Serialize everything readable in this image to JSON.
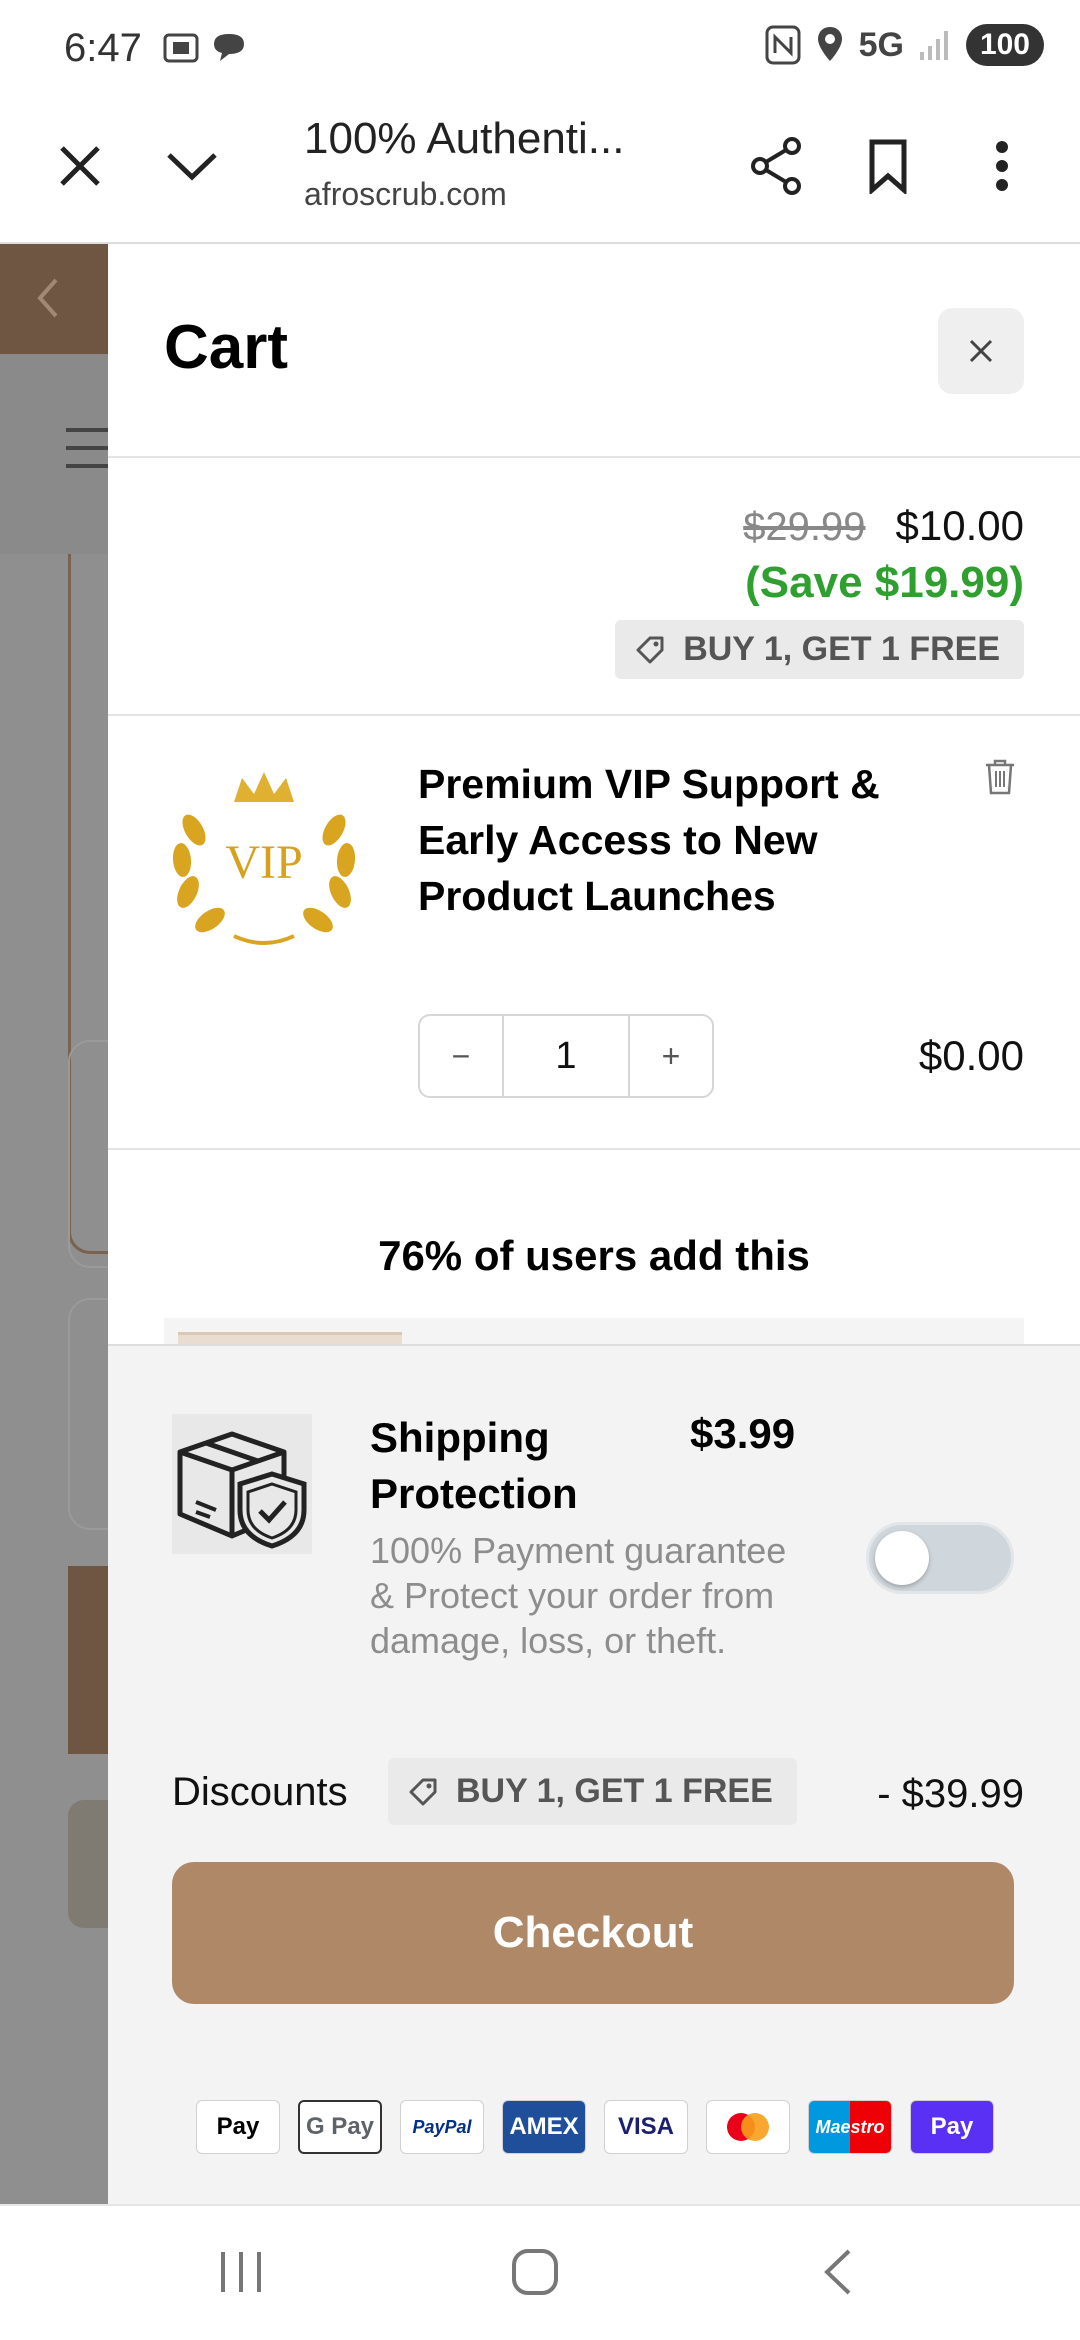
{
  "status_bar": {
    "time": "6:47",
    "network": "5G",
    "battery": "100",
    "icons": [
      "screenshot-icon",
      "chat-bubble-icon",
      "nfc-icon",
      "location-icon",
      "signal-icon"
    ]
  },
  "browser": {
    "page_title": "100% Authenti...",
    "url": "afroscrub.com",
    "actions": [
      "close-icon",
      "chevron-down-icon",
      "share-icon",
      "bookmark-icon",
      "more-icon"
    ]
  },
  "cart": {
    "title": "Cart",
    "item_1": {
      "old_price": "$29.99",
      "new_price": "$10.00",
      "save_text": "(Save $19.99)",
      "offer_tag": "BUY 1, GET 1 FREE"
    },
    "item_2": {
      "image_text": "VIP",
      "name": "Premium VIP Support & Early Access to New Product Launches",
      "quantity": "1",
      "minus": "−",
      "plus": "+",
      "price": "$0.00"
    },
    "upsell_title": "76% of users add this",
    "shipping": {
      "title": "Shipping Protection",
      "price": "$3.99",
      "description": "100% Payment guarantee & Protect your order from damage, loss, or theft.",
      "enabled": false
    },
    "discounts": {
      "label": "Discounts",
      "tag": "BUY 1, GET 1 FREE",
      "amount": "- $39.99"
    },
    "checkout_label": "Checkout",
    "payment_methods": [
      {
        "label": " Pay",
        "bg": "#ffffff",
        "fg": "#000000"
      },
      {
        "label": "G Pay",
        "bg": "#ffffff",
        "fg": "#5f6368"
      },
      {
        "label": "PayPal",
        "bg": "#ffffff",
        "fg": "#003087"
      },
      {
        "label": "AMEX",
        "bg": "#1f4e9b",
        "fg": "#ffffff"
      },
      {
        "label": "VISA",
        "bg": "#ffffff",
        "fg": "#1a1f71"
      },
      {
        "label": "",
        "bg": "#ffffff",
        "fg": "#eb001b"
      },
      {
        "label": "Maestro",
        "bg": "#ffffff",
        "fg": "#0099df"
      },
      {
        "label": "Pay",
        "bg": "#5a31f4",
        "fg": "#ffffff"
      }
    ]
  },
  "colors": {
    "checkout_bg": "#ae8867",
    "save_green": "#2fa02f",
    "brand_brown": "#6f5642"
  }
}
